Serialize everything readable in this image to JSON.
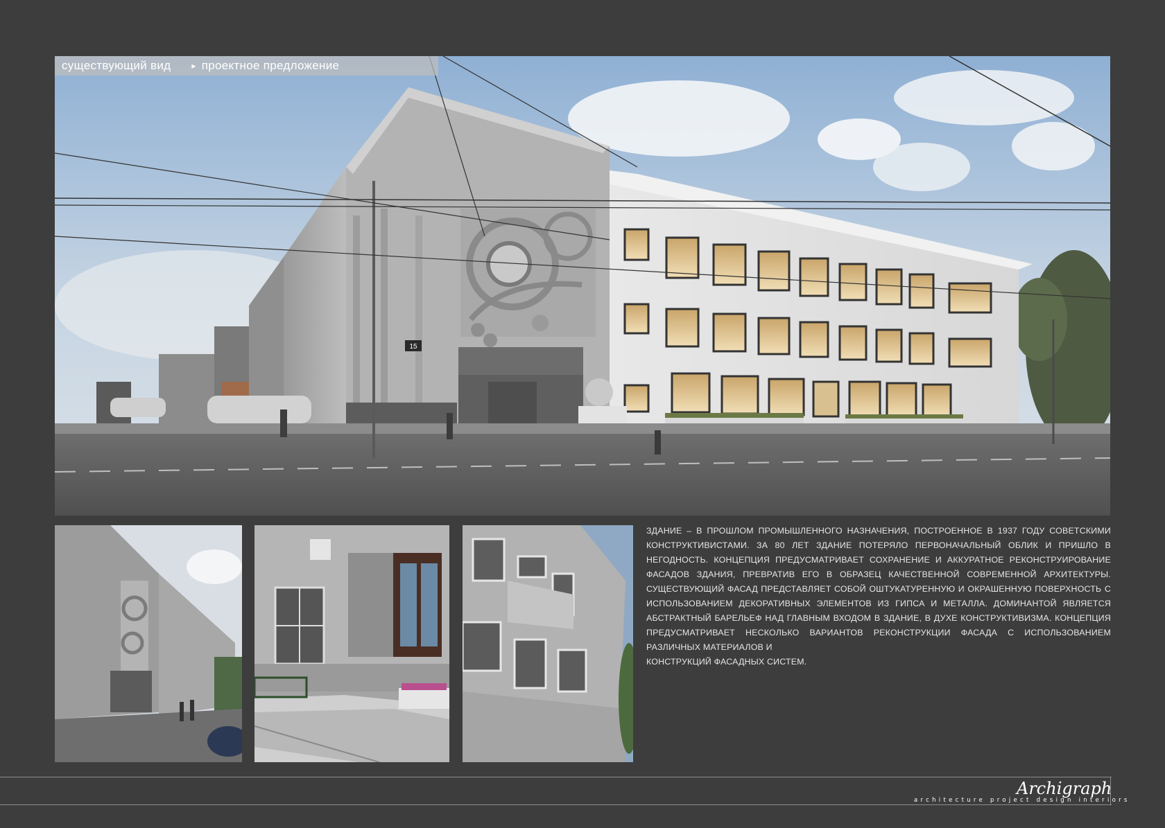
{
  "tabs": {
    "existing_view": "существующий вид",
    "proposal": "проектное предложение"
  },
  "photos": {
    "hero": "proposal-rendering",
    "thumbs": [
      "facade-corner-photo",
      "entrance-steps-photo",
      "balcony-facade-photo"
    ]
  },
  "hero_sign_number": "15",
  "description": {
    "paragraph": "Здание – в прошлом промышленного назначения, построенное в 1937 году советскими конструктивистами. За 80 лет здание потеряло первоначальный облик и пришло в негодность. Концепция предусматривает сохранение и аккуратное реконструирование фасадов здания, превратив его в образец качественной современной архитектуры. Существующий фасад представляет собой оштукатуренную и окрашенную поверхность с использованием декоративных элементов из гипса и металла. Доминантой является абстрактный барельеф над главным входом в здание, в духе конструктивизма. Концепция предусматривает несколько вариантов реконструкции фасада с использованием различных материалов и",
    "last_line": "конструкций фасадных систем."
  },
  "footer": {
    "logo": "Archigraph",
    "tagline": "architecture project design interiors"
  },
  "colors": {
    "background": "#3d3d3d",
    "text": "#e6e6e6",
    "tab_bar": "#bebebe"
  }
}
